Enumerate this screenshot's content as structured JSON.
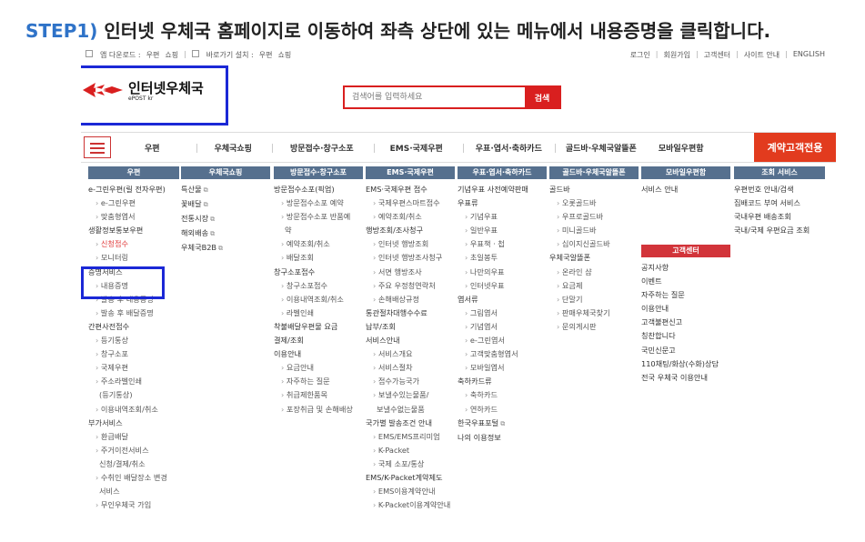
{
  "step": {
    "label": "STEP1)",
    "text": "인터넷 우체국 홈페이지로 이동하여 좌측 상단에 있는 메뉴에서 내용증명을 클릭합니다."
  },
  "topbar": {
    "app_download": "앱 다운로드 :",
    "app_post": "우편",
    "app_shop": "쇼핑",
    "shortcut": "바로가기 설치 :",
    "sc_post": "우편",
    "sc_shop": "쇼핑",
    "util": [
      "로그인",
      "회원가입",
      "고객센터",
      "사이트 안내",
      "ENGLISH"
    ]
  },
  "logo": {
    "name": "인터넷우체국",
    "sub": "ePOST kr"
  },
  "search": {
    "placeholder": "검색어를 입력하세요",
    "button": "검색"
  },
  "nav": {
    "items": [
      "우편",
      "우체국쇼핑",
      "방문접수·창구소포",
      "EMS·국제우편",
      "우표·엽서·축하카드",
      "골드바·우체국알뜰폰",
      "모바일우편함"
    ],
    "corporate": "계약고객전용"
  },
  "colors": {
    "accent_red": "#e23b1e",
    "highlight_blue": "#1b28d6",
    "header_blue": "#56708e",
    "title_blue": "#2f73c8"
  },
  "menu": {
    "col1": {
      "head": "우편",
      "items": [
        {
          "t": "e-그린우편(릴 전자우편)",
          "k": "main"
        },
        {
          "t": "e-그린우편",
          "k": "sub"
        },
        {
          "t": "맞춤형엽서",
          "k": "sub"
        },
        {
          "t": "생활정보통보우편",
          "k": "main"
        },
        {
          "t": "신청접수",
          "k": "sub red"
        },
        {
          "t": "모니터링",
          "k": "sub"
        },
        {
          "t": "증명서비스",
          "k": "main"
        },
        {
          "t": "내용증명",
          "k": "sub"
        },
        {
          "t": "발송 후 내용증명",
          "k": "sub"
        },
        {
          "t": "발송 후 배달증명",
          "k": "sub"
        },
        {
          "t": "간편사전접수",
          "k": "main"
        },
        {
          "t": "등기통상",
          "k": "sub"
        },
        {
          "t": "창구소포",
          "k": "sub"
        },
        {
          "t": "국제우편",
          "k": "sub"
        },
        {
          "t": "주소라벨인쇄",
          "k": "sub"
        },
        {
          "t": "(등기통상)",
          "k": "cont"
        },
        {
          "t": "이용내역조회/취소",
          "k": "sub"
        },
        {
          "t": "부가서비스",
          "k": "main"
        },
        {
          "t": "환급배달",
          "k": "sub"
        },
        {
          "t": "주거이전서비스",
          "k": "sub"
        },
        {
          "t": "신청/결제/취소",
          "k": "cont"
        },
        {
          "t": "수취인 배달장소 변경",
          "k": "sub"
        },
        {
          "t": "서비스",
          "k": "cont"
        },
        {
          "t": "무인우체국 가입",
          "k": "sub"
        }
      ]
    },
    "col2": {
      "head": "우체국쇼핑",
      "items": [
        {
          "t": "특산물",
          "k": "main",
          "ext": true
        },
        {
          "t": "꽃배달",
          "k": "main",
          "ext": true
        },
        {
          "t": "전통시장",
          "k": "main",
          "ext": true
        },
        {
          "t": "해외배송",
          "k": "main",
          "ext": true
        },
        {
          "t": "우체국B2B",
          "k": "main",
          "ext": true
        }
      ]
    },
    "col3": {
      "head": "방문접수·창구소포",
      "items": [
        {
          "t": "방문접수소포(픽업)",
          "k": "main"
        },
        {
          "t": "방문접수소포 예약",
          "k": "sub"
        },
        {
          "t": "방문접수소포 반품예",
          "k": "sub"
        },
        {
          "t": "약",
          "k": "cont"
        },
        {
          "t": "예약조회/취소",
          "k": "sub"
        },
        {
          "t": "배달조회",
          "k": "sub"
        },
        {
          "t": "창구소포접수",
          "k": "main"
        },
        {
          "t": "창구소포접수",
          "k": "sub"
        },
        {
          "t": "이용내역조회/취소",
          "k": "sub"
        },
        {
          "t": "라벨인쇄",
          "k": "sub"
        },
        {
          "t": "착불배달우편물 요금",
          "k": "main"
        },
        {
          "t": "결제/조회",
          "k": "main"
        },
        {
          "t": "이용안내",
          "k": "main"
        },
        {
          "t": "요금안내",
          "k": "sub"
        },
        {
          "t": "자주하는 질문",
          "k": "sub"
        },
        {
          "t": "취급제한품목",
          "k": "sub"
        },
        {
          "t": "포장취급 및 손해배상",
          "k": "sub"
        }
      ]
    },
    "col4": {
      "head": "EMS·국제우편",
      "items": [
        {
          "t": "EMS·국제우편 접수",
          "k": "main"
        },
        {
          "t": "국제우편스마트접수",
          "k": "sub"
        },
        {
          "t": "예약조회/취소",
          "k": "sub"
        },
        {
          "t": "행방조회/조사청구",
          "k": "main"
        },
        {
          "t": "인터넷 행방조회",
          "k": "sub"
        },
        {
          "t": "인터넷 행방조사청구",
          "k": "sub"
        },
        {
          "t": "서면 행방조사",
          "k": "sub"
        },
        {
          "t": "주요 우정청연락처",
          "k": "sub"
        },
        {
          "t": "손해배상규정",
          "k": "sub"
        },
        {
          "t": "통관절차대행수수료",
          "k": "main"
        },
        {
          "t": "납부/조회",
          "k": "main"
        },
        {
          "t": "서비스안내",
          "k": "main"
        },
        {
          "t": "서비스개요",
          "k": "sub"
        },
        {
          "t": "서비스절차",
          "k": "sub"
        },
        {
          "t": "접수가능국가",
          "k": "sub"
        },
        {
          "t": "보낼수있는물품/",
          "k": "sub"
        },
        {
          "t": "보낼수없는물품",
          "k": "cont"
        },
        {
          "t": "국가별 발송조건 안내",
          "k": "main"
        },
        {
          "t": "EMS/EMS프리미엄",
          "k": "sub"
        },
        {
          "t": "K-Packet",
          "k": "sub"
        },
        {
          "t": "국제 소포/통상",
          "k": "sub"
        },
        {
          "t": "EMS/K-Packet계약제도",
          "k": "main"
        },
        {
          "t": "EMS이용계약안내",
          "k": "sub"
        },
        {
          "t": "K-Packet이용계약안내",
          "k": "sub"
        }
      ]
    },
    "col5": {
      "head": "우표·엽서·축하카드",
      "items": [
        {
          "t": "기념우표 사전예약판매",
          "k": "main"
        },
        {
          "t": "우표류",
          "k": "main"
        },
        {
          "t": "기념우표",
          "k": "sub"
        },
        {
          "t": "일반우표",
          "k": "sub"
        },
        {
          "t": "우표책 · 첩",
          "k": "sub"
        },
        {
          "t": "초일봉투",
          "k": "sub"
        },
        {
          "t": "나만의우표",
          "k": "sub"
        },
        {
          "t": "인터넷우표",
          "k": "sub"
        },
        {
          "t": "엽서류",
          "k": "main"
        },
        {
          "t": "그림엽서",
          "k": "sub"
        },
        {
          "t": "기념엽서",
          "k": "sub"
        },
        {
          "t": "e-그린엽서",
          "k": "sub"
        },
        {
          "t": "고객맞춤형엽서",
          "k": "sub"
        },
        {
          "t": "모바일엽서",
          "k": "sub"
        },
        {
          "t": "축하카드류",
          "k": "main"
        },
        {
          "t": "축하카드",
          "k": "sub"
        },
        {
          "t": "연하카드",
          "k": "sub"
        },
        {
          "t": "한국우표포털",
          "k": "main",
          "ext": true
        },
        {
          "t": "나의 이용정보",
          "k": "main"
        }
      ]
    },
    "col6": {
      "head": "골드바·우체국알뜰폰",
      "items": [
        {
          "t": "골드바",
          "k": "main"
        },
        {
          "t": "오롯골드바",
          "k": "sub"
        },
        {
          "t": "우프로골드바",
          "k": "sub"
        },
        {
          "t": "미니골드바",
          "k": "sub"
        },
        {
          "t": "십이지신골드바",
          "k": "sub"
        },
        {
          "t": "우체국알뜰폰",
          "k": "main"
        },
        {
          "t": "온라인 샵",
          "k": "sub"
        },
        {
          "t": "요금제",
          "k": "sub"
        },
        {
          "t": "단말기",
          "k": "sub"
        },
        {
          "t": "판매우체국찾기",
          "k": "sub"
        },
        {
          "t": "문의게시판",
          "k": "sub"
        }
      ]
    },
    "col7": {
      "head": "모바일우편함",
      "items": [
        {
          "t": "서비스 안내",
          "k": "main"
        }
      ]
    },
    "col7b": {
      "head": "고객센터",
      "items": [
        {
          "t": "공지사항",
          "k": "main"
        },
        {
          "t": "이벤트",
          "k": "main"
        },
        {
          "t": "자주하는 질문",
          "k": "main"
        },
        {
          "t": "이용안내",
          "k": "main"
        },
        {
          "t": "고객불편신고",
          "k": "main"
        },
        {
          "t": "칭찬합니다",
          "k": "main"
        },
        {
          "t": "국민신문고",
          "k": "main"
        },
        {
          "t": "110채팅/화상(수화)상담",
          "k": "main"
        },
        {
          "t": "전국 우체국 이용안내",
          "k": "main"
        }
      ]
    },
    "col8": {
      "head": "조회 서비스",
      "items": [
        {
          "t": "우편번호 안내/검색",
          "k": "main"
        },
        {
          "t": "집배코드 부여 서비스",
          "k": "main"
        },
        {
          "t": "국내우편 배송조회",
          "k": "main"
        },
        {
          "t": "국내/국제 우편요금 조회",
          "k": "main"
        }
      ]
    }
  }
}
